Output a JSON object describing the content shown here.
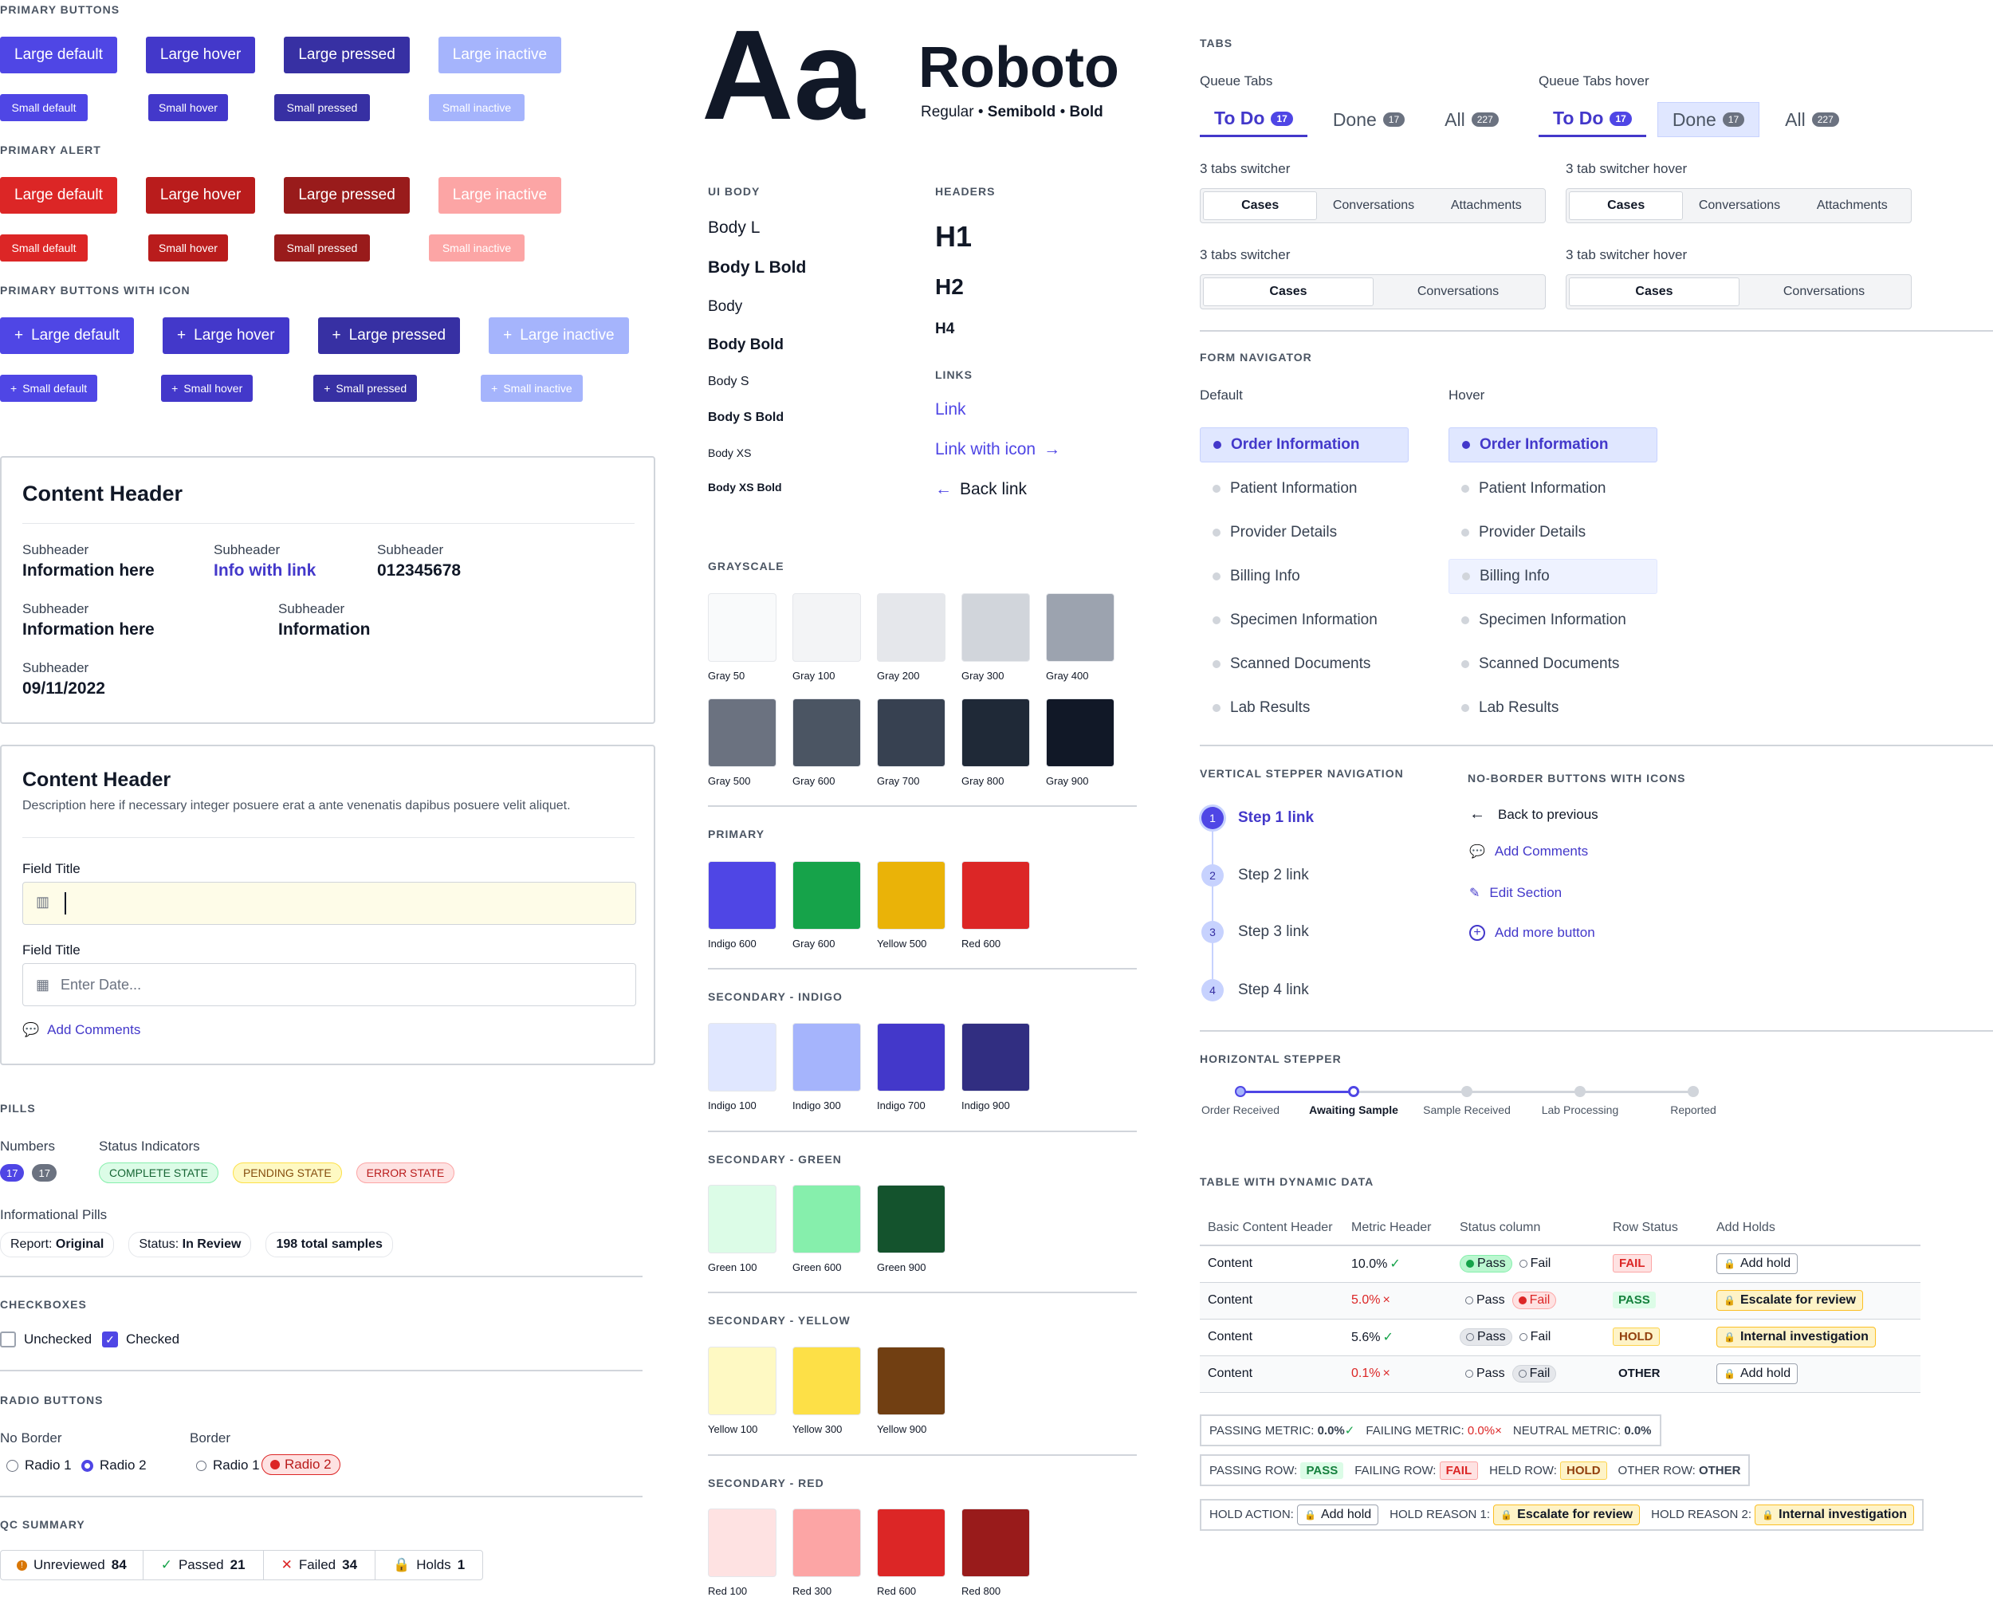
{
  "primary_buttons": {
    "title": "PRIMARY BUTTONS",
    "large": [
      "Large default",
      "Large hover",
      "Large pressed",
      "Large inactive"
    ],
    "small": [
      "Small default",
      "Small hover",
      "Small pressed",
      "Small inactive"
    ]
  },
  "primary_alert": {
    "title": "PRIMARY ALERT",
    "large": [
      "Large default",
      "Large hover",
      "Large pressed",
      "Large inactive"
    ],
    "small": [
      "Small default",
      "Small hover",
      "Small pressed",
      "Small inactive"
    ]
  },
  "icon_buttons": {
    "title": "PRIMARY BUTTONS WITH ICON",
    "large": [
      "Large default",
      "Large hover",
      "Large pressed",
      "Large inactive"
    ],
    "small": [
      "Small default",
      "Small hover",
      "Small pressed",
      "Small inactive"
    ]
  },
  "content1": {
    "title": "Content Header",
    "sub": "Subheader",
    "r1": [
      "Information here",
      "Info with link",
      "012345678"
    ],
    "r2": [
      "Information here",
      "Information"
    ],
    "r3": "09/11/2022"
  },
  "content2": {
    "title": "Content Header",
    "desc": "Description here if necessary integer posuere erat a ante venenatis dapibus posuere velit aliquet.",
    "field1": "Field Title",
    "field2": "Field Title",
    "date_placeholder": "Enter Date...",
    "add_comments": "Add Comments"
  },
  "pills": {
    "title": "PILLS",
    "numbers_label": "Numbers",
    "numbers": [
      "17",
      "17"
    ],
    "status_label": "Status Indicators",
    "status": [
      "COMPLETE STATE",
      "PENDING STATE",
      "ERROR STATE"
    ],
    "info_label": "Informational Pills",
    "info": [
      {
        "k": "Report:",
        "v": "Original"
      },
      {
        "k": "Status:",
        "v": "In Review"
      },
      {
        "k": "",
        "v": "198 total samples"
      }
    ]
  },
  "checkboxes": {
    "title": "CHECKBOXES",
    "unchecked": "Unchecked",
    "checked": "Checked"
  },
  "radios": {
    "title": "RADIO BUTTONS",
    "no_border": "No Border",
    "border": "Border",
    "r1": "Radio 1",
    "r2": "Radio 2"
  },
  "qc": {
    "title": "QC SUMMARY",
    "items": [
      {
        "label": "Unreviewed",
        "n": "84"
      },
      {
        "label": "Passed",
        "n": "21"
      },
      {
        "label": "Failed",
        "n": "34"
      },
      {
        "label": "Holds",
        "n": "1"
      }
    ]
  },
  "type": {
    "aa": "Aa",
    "font": "Roboto",
    "w1": "Regular",
    "w2": "Semibold",
    "w3": "Bold",
    "sep": "•"
  },
  "ui_body": {
    "title": "UI BODY",
    "items": [
      "Body L",
      "Body L Bold",
      "Body",
      "Body Bold",
      "Body S",
      "Body S Bold",
      "Body XS",
      "Body XS Bold"
    ]
  },
  "headers": {
    "title": "HEADERS",
    "h1": "H1",
    "h2": "H2",
    "h4": "H4"
  },
  "links": {
    "title": "LINKS",
    "link": "Link",
    "link_icon": "Link with icon",
    "back": "Back link"
  },
  "grayscale": {
    "title": "GRAYSCALE",
    "colors": [
      {
        "n": "Gray 50",
        "c": "#f9fafb"
      },
      {
        "n": "Gray 100",
        "c": "#f3f4f6"
      },
      {
        "n": "Gray 200",
        "c": "#e5e7eb"
      },
      {
        "n": "Gray 300",
        "c": "#d1d5db"
      },
      {
        "n": "Gray 400",
        "c": "#9ca3af"
      },
      {
        "n": "Gray 500",
        "c": "#6b7280"
      },
      {
        "n": "Gray 600",
        "c": "#4b5563"
      },
      {
        "n": "Gray 700",
        "c": "#374151"
      },
      {
        "n": "Gray 800",
        "c": "#1f2937"
      },
      {
        "n": "Gray 900",
        "c": "#111827"
      }
    ]
  },
  "primary": {
    "title": "PRIMARY",
    "colors": [
      {
        "n": "Indigo 600",
        "c": "#4f46e5"
      },
      {
        "n": "Gray 600",
        "c": "#16a34a"
      },
      {
        "n": "Yellow 500",
        "c": "#eab308"
      },
      {
        "n": "Red 600",
        "c": "#dc2626"
      }
    ]
  },
  "sec_indigo": {
    "title": "SECONDARY - INDIGO",
    "colors": [
      {
        "n": "Indigo 100",
        "c": "#e0e7ff"
      },
      {
        "n": "Indigo 300",
        "c": "#a5b4fc"
      },
      {
        "n": "Indigo 700",
        "c": "#4338ca"
      },
      {
        "n": "Indigo 900",
        "c": "#312e81"
      }
    ]
  },
  "sec_green": {
    "title": "SECONDARY - GREEN",
    "colors": [
      {
        "n": "Green 100",
        "c": "#dcfce7"
      },
      {
        "n": "Green 600",
        "c": "#86efac"
      },
      {
        "n": "Green 900",
        "c": "#14532d"
      }
    ]
  },
  "sec_yellow": {
    "title": "SECONDARY - YELLOW",
    "colors": [
      {
        "n": "Yellow 100",
        "c": "#fef9c3"
      },
      {
        "n": "Yellow 300",
        "c": "#fde047"
      },
      {
        "n": "Yellow 900",
        "c": "#713f12"
      }
    ]
  },
  "sec_red": {
    "title": "SECONDARY - RED",
    "colors": [
      {
        "n": "Red 100",
        "c": "#fee2e2"
      },
      {
        "n": "Red 300",
        "c": "#fca5a5"
      },
      {
        "n": "Red 600",
        "c": "#dc2626"
      },
      {
        "n": "Red 800",
        "c": "#991b1b"
      }
    ]
  },
  "tabs": {
    "title": "TABS",
    "queue": "Queue Tabs",
    "queue_hover": "Queue Tabs hover",
    "items": [
      {
        "l": "To Do",
        "n": "17"
      },
      {
        "l": "Done",
        "n": "17"
      },
      {
        "l": "All",
        "n": "227"
      }
    ],
    "sw3": "3 tabs switcher",
    "sw3h": "3 tab switcher hover",
    "sw3_items": [
      "Cases",
      "Conversations",
      "Attachments"
    ],
    "sw2": "3 tabs switcher",
    "sw2h": "3 tab switcher hover",
    "sw2_items": [
      "Cases",
      "Conversations"
    ]
  },
  "form_nav": {
    "title": "FORM NAVIGATOR",
    "default": "Default",
    "hover": "Hover",
    "items": [
      "Order Information",
      "Patient Information",
      "Provider Details",
      "Billing Info",
      "Specimen Information",
      "Scanned Documents",
      "Lab Results"
    ]
  },
  "vstepper": {
    "title": "VERTICAL STEPPER NAVIGATION",
    "steps": [
      {
        "n": "1",
        "l": "Step 1 link"
      },
      {
        "n": "2",
        "l": "Step 2 link"
      },
      {
        "n": "3",
        "l": "Step 3 link"
      },
      {
        "n": "4",
        "l": "Step 4 link"
      }
    ]
  },
  "noborder": {
    "title": "NO-BORDER BUTTONS WITH ICONS",
    "items": [
      "Back to previous",
      "Add Comments",
      "Edit Section",
      "Add more button"
    ]
  },
  "hstepper": {
    "title": "HORIZONTAL STEPPER",
    "steps": [
      "Order Received",
      "Awaiting Sample",
      "Sample Received",
      "Lab Processing",
      "Reported"
    ]
  },
  "table": {
    "title": "TABLE WITH DYNAMIC DATA",
    "headers": [
      "Basic Content Header",
      "Metric Header",
      "Status column",
      "Row Status",
      "Add Holds"
    ],
    "rows": [
      {
        "c": "Content",
        "m": "10.0%",
        "mk": "✓",
        "mt": "pos",
        "p": "pass",
        "rs": "FAIL",
        "rst": "fail",
        "hold": "Add hold",
        "ht": "plain"
      },
      {
        "c": "Content",
        "m": "5.0%",
        "mk": "×",
        "mt": "neg",
        "p": "fail",
        "rs": "PASS",
        "rst": "pass",
        "hold": "Escalate for review",
        "ht": "yellow"
      },
      {
        "c": "Content",
        "m": "5.6%",
        "mk": "✓",
        "mt": "pos",
        "p": "neutral-pass",
        "rs": "HOLD",
        "rst": "hold",
        "hold": "Internal investigation",
        "ht": "yellow"
      },
      {
        "c": "Content",
        "m": "0.1%",
        "mk": "×",
        "mt": "neg",
        "p": "neutral-fail",
        "rs": "OTHER",
        "rst": "other",
        "hold": "Add hold",
        "ht": "plain"
      }
    ],
    "pass": "Pass",
    "fail": "Fail"
  },
  "legend1": {
    "a": "PASSING METRIC:",
    "av": "0.0%",
    "b": "FAILING METRIC:",
    "bv": "0.0%",
    "c": "NEUTRAL METRIC:",
    "cv": "0.0%"
  },
  "legend2": {
    "a": "PASSING ROW:",
    "av": "PASS",
    "b": "FAILING ROW:",
    "bv": "FAIL",
    "c": "HELD ROW:",
    "cv": "HOLD",
    "d": "OTHER ROW:",
    "dv": "OTHER"
  },
  "legend3": {
    "a": "HOLD ACTION:",
    "av": "Add hold",
    "b": "HOLD REASON 1:",
    "bv": "Escalate for review",
    "c": "HOLD REASON 2:",
    "cv": "Internal investigation"
  }
}
